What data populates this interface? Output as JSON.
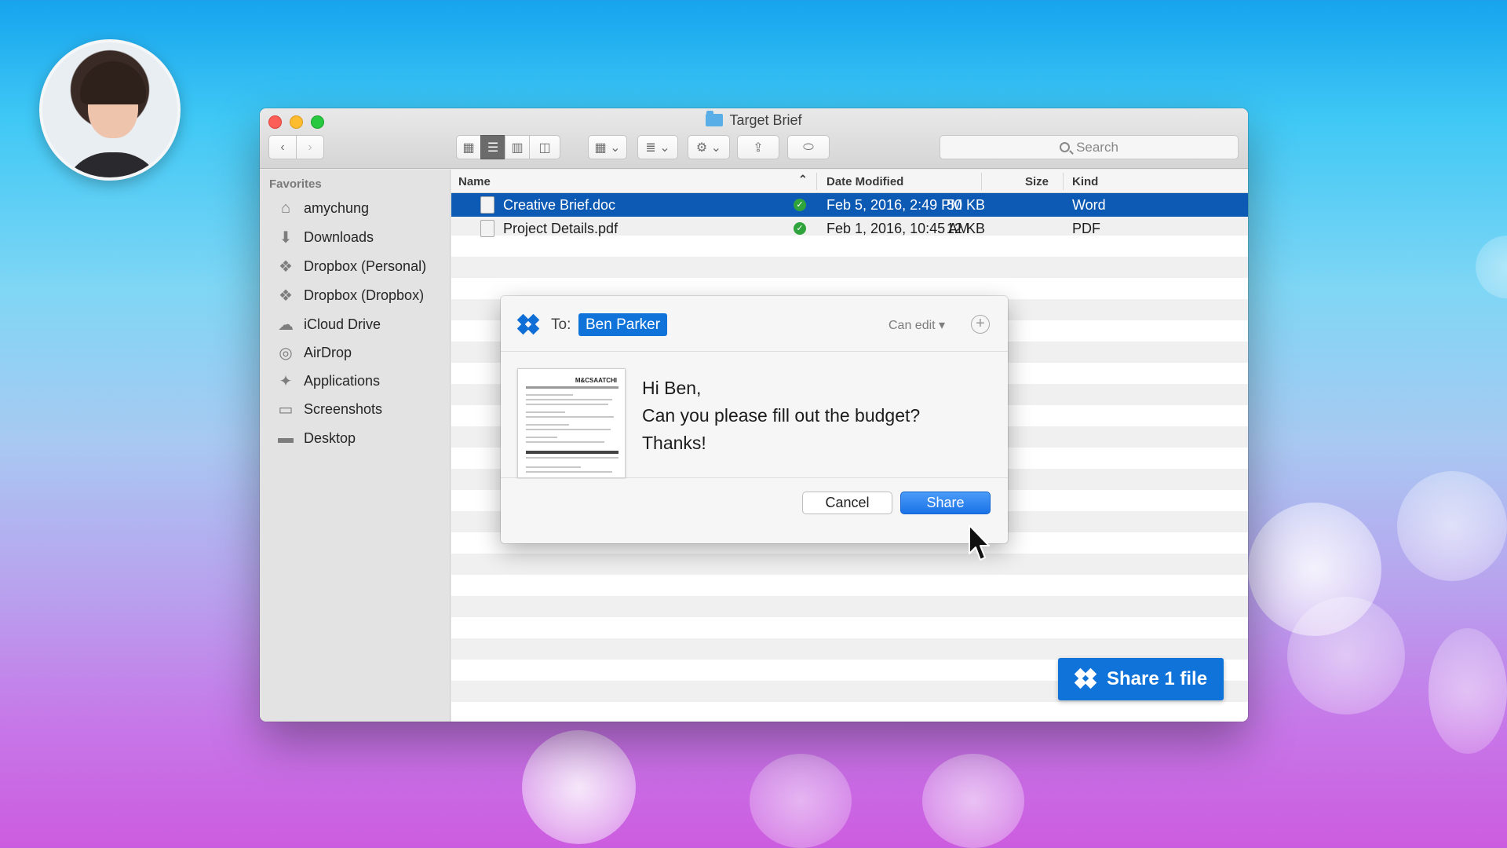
{
  "window": {
    "title": "Target Brief",
    "search_placeholder": "Search"
  },
  "sidebar": {
    "heading": "Favorites",
    "items": [
      {
        "label": "amychung",
        "icon": "home-icon"
      },
      {
        "label": "Downloads",
        "icon": "download-icon"
      },
      {
        "label": "Dropbox (Personal)",
        "icon": "dropbox-icon"
      },
      {
        "label": "Dropbox (Dropbox)",
        "icon": "dropbox-icon"
      },
      {
        "label": "iCloud Drive",
        "icon": "cloud-icon"
      },
      {
        "label": "AirDrop",
        "icon": "airdrop-icon"
      },
      {
        "label": "Applications",
        "icon": "applications-icon"
      },
      {
        "label": "Screenshots",
        "icon": "folder-icon"
      },
      {
        "label": "Desktop",
        "icon": "desktop-icon"
      }
    ]
  },
  "columns": {
    "name": "Name",
    "date": "Date Modified",
    "size": "Size",
    "kind": "Kind"
  },
  "files": [
    {
      "name": "Creative Brief.doc",
      "date": "Feb 5, 2016, 2:49 PM",
      "size": "50 KB",
      "kind": "Word",
      "selected": true
    },
    {
      "name": "Project Details.pdf",
      "date": "Feb 1, 2016, 10:45 AM",
      "size": "12 KB",
      "kind": "PDF",
      "selected": false
    }
  ],
  "dialog": {
    "to_label": "To:",
    "recipient": "Ben Parker",
    "permission": "Can edit",
    "message_lines": [
      "Hi Ben,",
      "Can you please fill out the budget?",
      "Thanks!"
    ],
    "thumb_logo": "M&CSAATCHI",
    "cancel_label": "Cancel",
    "share_label": "Share"
  },
  "share_bar": {
    "label": "Share 1 file"
  },
  "colors": {
    "accent": "#0f73d9",
    "selection": "#0d5ab5",
    "sync_green": "#2fa33c"
  }
}
